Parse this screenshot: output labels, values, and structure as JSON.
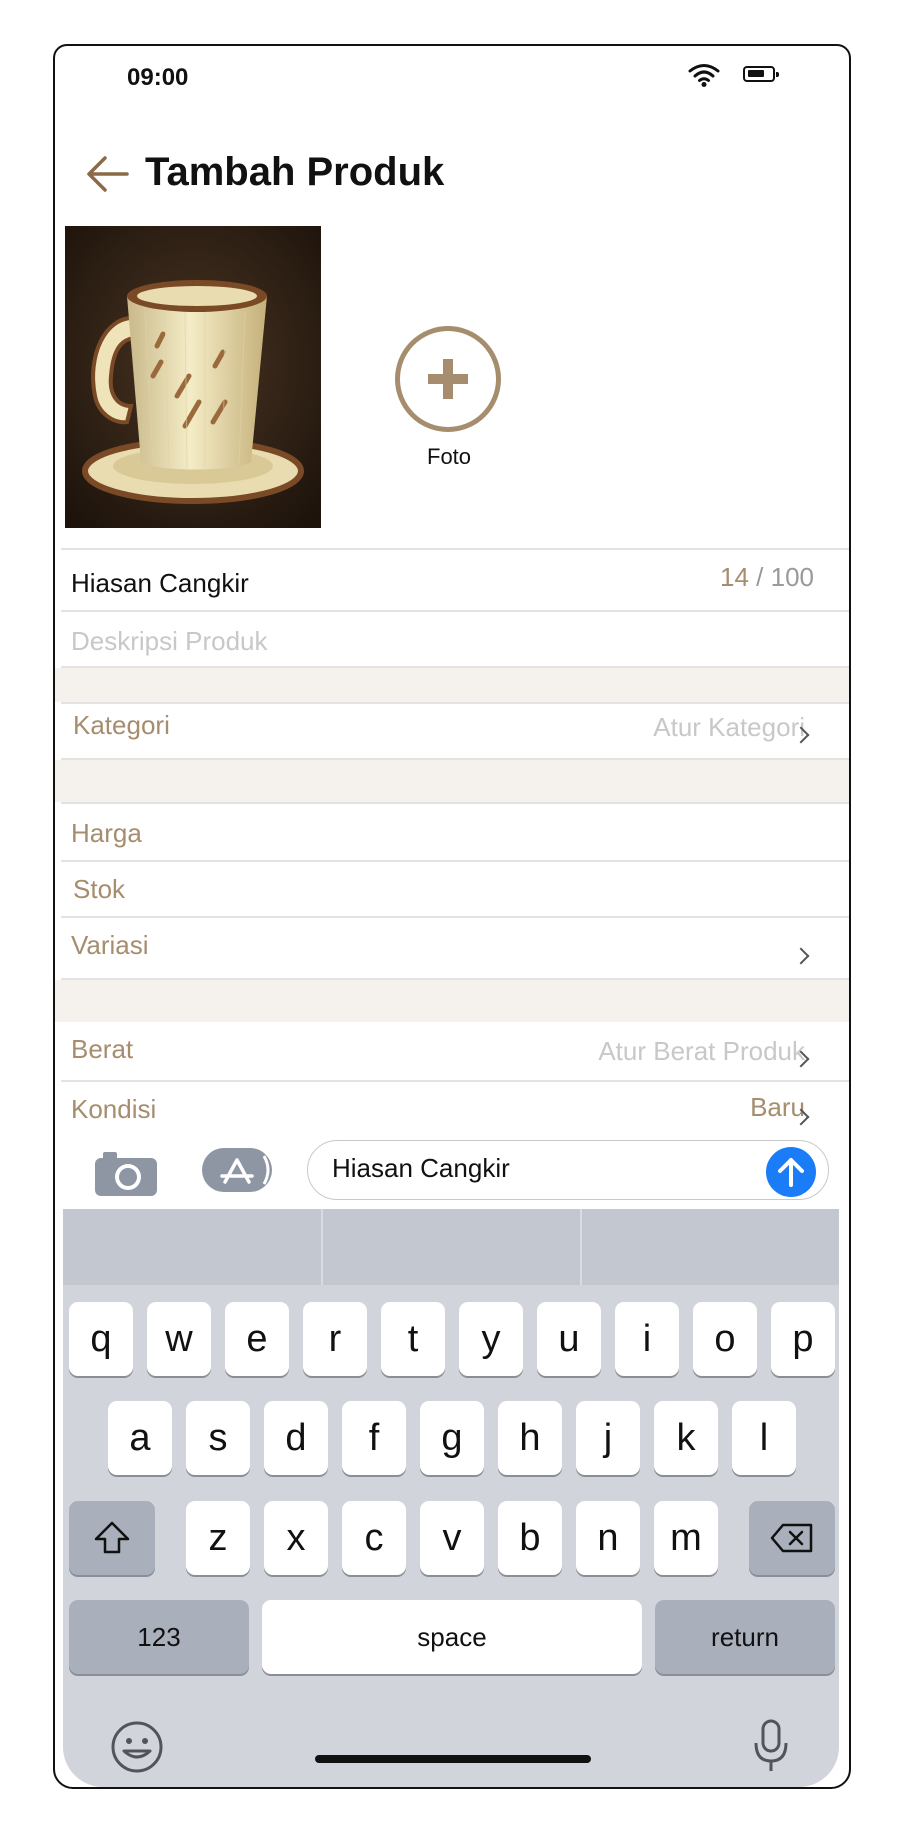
{
  "status": {
    "time": "09:00"
  },
  "header": {
    "title": "Tambah Produk"
  },
  "photos": {
    "add_label": "Foto"
  },
  "form": {
    "product_name": "Hiasan Cangkir",
    "name_count": "14",
    "name_sep": "/",
    "name_max": "100",
    "description_placeholder": "Deskripsi Produk",
    "category_label": "Kategori",
    "category_value": "Atur Kategori",
    "price_label": "Harga",
    "stock_label": "Stok",
    "variation_label": "Variasi",
    "weight_label": "Berat",
    "weight_value": "Atur Berat Produk",
    "condition_label": "Kondisi",
    "condition_value": "Baru"
  },
  "message": {
    "text": "Hiasan Cangkir"
  },
  "keyboard": {
    "row1": [
      "q",
      "w",
      "e",
      "r",
      "t",
      "y",
      "u",
      "i",
      "o",
      "p"
    ],
    "row2": [
      "a",
      "s",
      "d",
      "f",
      "g",
      "h",
      "j",
      "k",
      "l"
    ],
    "row3": [
      "z",
      "x",
      "c",
      "v",
      "b",
      "n",
      "m"
    ],
    "numbers_label": "123",
    "space_label": "space",
    "return_label": "return"
  },
  "colors": {
    "accent": "#a58d6e",
    "send": "#1a7cf6"
  }
}
